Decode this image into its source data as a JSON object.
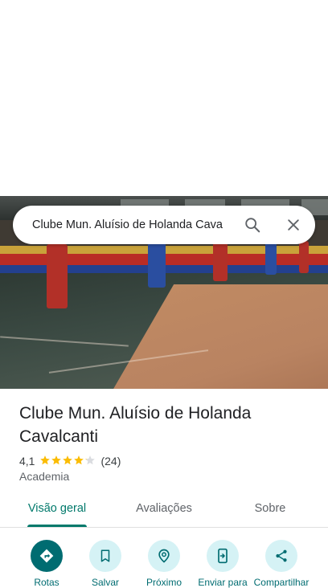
{
  "search": {
    "query": "Clube Mun. Aluísio de Holanda Cava"
  },
  "place": {
    "name": "Clube Mun. Aluísio de Holanda Cavalcanti",
    "rating": "4,1",
    "stars": 4.1,
    "reviews": "(24)",
    "category": "Academia"
  },
  "tabs": [
    {
      "label": "Visão geral",
      "active": true
    },
    {
      "label": "Avaliações",
      "active": false
    },
    {
      "label": "Sobre",
      "active": false
    }
  ],
  "actions": [
    {
      "label": "Rotas",
      "icon": "directions-icon"
    },
    {
      "label": "Salvar",
      "icon": "bookmark-icon"
    },
    {
      "label": "Próximo",
      "icon": "nearby-icon"
    },
    {
      "label": "Enviar para",
      "icon": "send-to-phone-icon"
    },
    {
      "label": "Compartilhar",
      "icon": "share-icon"
    }
  ],
  "colors": {
    "accent": "#00796b",
    "star": "#fbbc04",
    "action_bg": "#d5f2f5"
  }
}
